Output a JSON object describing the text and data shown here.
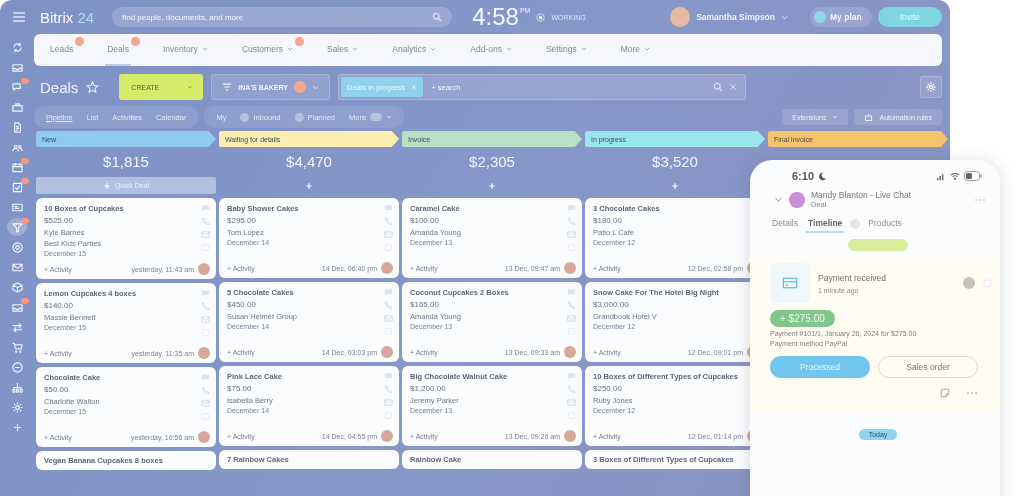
{
  "top_bar": {
    "logo_name": "Bitrix",
    "logo_number": "24",
    "search": {
      "placeholder": "find people, documents, and more"
    },
    "time": "4:58",
    "meridiem": "PM",
    "status": "WORKING",
    "user": "Samantha Simpson",
    "plan": "My plan",
    "invite": "Invite"
  },
  "sidebar": {
    "items": [
      {
        "kind": "sync",
        "badge": false,
        "selected": false
      },
      {
        "kind": "inbox",
        "badge": false,
        "selected": false
      },
      {
        "kind": "chat",
        "badge": true,
        "selected": false
      },
      {
        "kind": "briefcase",
        "badge": false,
        "selected": false
      },
      {
        "kind": "doc",
        "badge": false,
        "selected": false
      },
      {
        "kind": "people",
        "badge": false,
        "selected": false
      },
      {
        "kind": "calendar",
        "badge": true,
        "selected": false
      },
      {
        "kind": "check",
        "badge": true,
        "selected": false
      },
      {
        "kind": "idcard",
        "badge": false,
        "selected": false
      },
      {
        "kind": "funnel",
        "badge": true,
        "selected": true
      },
      {
        "kind": "target",
        "badge": false,
        "selected": false
      },
      {
        "kind": "mail",
        "badge": false,
        "selected": false
      },
      {
        "kind": "box",
        "badge": false,
        "selected": false
      },
      {
        "kind": "inbox",
        "badge": true,
        "selected": false
      },
      {
        "kind": "arrows",
        "badge": false,
        "selected": false
      },
      {
        "kind": "cart",
        "badge": false,
        "selected": false
      },
      {
        "kind": "minus",
        "badge": false,
        "selected": false
      },
      {
        "kind": "tree",
        "badge": false,
        "selected": false
      },
      {
        "kind": "gear",
        "badge": false,
        "selected": false
      },
      {
        "kind": "plus",
        "badge": false,
        "selected": false
      }
    ]
  },
  "nav": {
    "tabs": [
      {
        "label": "Leads",
        "badge": true,
        "dropdown": false,
        "selected": false
      },
      {
        "label": "Deals",
        "badge": true,
        "dropdown": false,
        "selected": true
      },
      {
        "label": "Inventory",
        "badge": false,
        "dropdown": true,
        "selected": false
      },
      {
        "label": "Customers",
        "badge": true,
        "dropdown": true,
        "selected": false
      },
      {
        "label": "Sales",
        "badge": false,
        "dropdown": true,
        "selected": false
      },
      {
        "label": "Analytics",
        "badge": false,
        "dropdown": true,
        "selected": false
      },
      {
        "label": "Add-ons",
        "badge": false,
        "dropdown": true,
        "selected": false
      },
      {
        "label": "Settings",
        "badge": false,
        "dropdown": true,
        "selected": false
      },
      {
        "label": "More",
        "badge": false,
        "dropdown": true,
        "selected": false
      }
    ]
  },
  "toolbar": {
    "title": "Deals",
    "create": "CREATE",
    "filter": "INA'S BAKERY",
    "search_tag": "Deals in progress",
    "search": {
      "placeholder": "+ search"
    }
  },
  "views": {
    "tabs": [
      {
        "label": "Pipeline",
        "selected": true
      },
      {
        "label": "List",
        "selected": false
      },
      {
        "label": "Activities",
        "selected": false
      },
      {
        "label": "Calendar",
        "selected": false
      }
    ],
    "filters": [
      {
        "label": "My",
        "kind": "plain"
      },
      {
        "label": "Inbound",
        "kind": "icon"
      },
      {
        "label": "Planned",
        "kind": "icon"
      },
      {
        "label": "More",
        "kind": "menu"
      }
    ],
    "extensions": "Extensions",
    "automation": "Automation rules"
  },
  "stages": [
    {
      "name": "New",
      "color": "#8fcbef",
      "total": "$1,815",
      "quick_add": "Quick Deal",
      "deals": [
        {
          "title": "10 Boxes of Cupcakes",
          "amount": "$525.00",
          "contact": "Kyle Barnes",
          "company": "Best Kids Parties",
          "date": "December 15",
          "timestamp": "yesterday, 11:43 am",
          "activity": "+ Activity"
        },
        {
          "title": "Lemon Cupcakes 4 boxes",
          "amount": "$140.00",
          "contact": "Massie Bennett",
          "date": "December 15",
          "timestamp": "yesterday, 11:35 am",
          "activity": "+ Activity"
        },
        {
          "title": "Chocolate Cake",
          "amount": "$50.00",
          "contact": "Charlotte Walton",
          "date": "December 15",
          "timestamp": "yesterday, 10:56 am",
          "activity": "+ Activity"
        },
        {
          "title": "Vegan Banana Cupcakes 8 boxes"
        }
      ]
    },
    {
      "name": "Waiting for details",
      "color": "#fbeeb0",
      "total": "$4,470",
      "deals": [
        {
          "title": "Baby Shower Cakes",
          "amount": "$295.00",
          "contact": "Tom Lopez",
          "date": "December 14",
          "timestamp": "14 Dec, 06:40 pm",
          "activity": "+ Activity"
        },
        {
          "title": "5 Chocolate Cakes",
          "amount": "$450.00",
          "contact": "Susan Helmet Group",
          "date": "December 14",
          "timestamp": "14 Dec, 03:03 pm",
          "activity": "+ Activity"
        },
        {
          "title": "Pink Lace Cake",
          "amount": "$75.00",
          "contact": "Isabella Berry",
          "date": "December 14",
          "timestamp": "14 Dec, 04:55 pm",
          "activity": "+ Activity"
        },
        {
          "title": "7 Rainbow Cakes"
        }
      ]
    },
    {
      "name": "Invoice",
      "color": "#b7e0c4",
      "total": "$2,305",
      "deals": [
        {
          "title": "Caramel Cake",
          "amount": "$100.00",
          "contact": "Amanda Young",
          "date": "December 13",
          "timestamp": "13 Dec, 09:47 am",
          "activity": "+ Activity"
        },
        {
          "title": "Coconut Cupcakes 2 Boxes",
          "amount": "$165.00",
          "contact": "Amanda Young",
          "date": "December 13",
          "timestamp": "13 Dec, 09:33 am",
          "activity": "+ Activity"
        },
        {
          "title": "Big Chocolate Walnut Cake",
          "amount": "$1,200.00",
          "contact": "Jeremy Parker",
          "date": "December 13",
          "timestamp": "13 Dec, 09:26 am",
          "activity": "+ Activity"
        },
        {
          "title": "Rainbow Cake"
        }
      ]
    },
    {
      "name": "In progress",
      "color": "#99e6ec",
      "total": "$3,520",
      "deals": [
        {
          "title": "3 Chocolate Cakes",
          "amount": "$180.00",
          "contact": "Patio L Cafe",
          "date": "December 12",
          "timestamp": "12 Dec, 02:58 pm",
          "activity": "+ Activity"
        },
        {
          "title": "Snow Cake For The Hotel Big Night",
          "amount": "$3,000.00",
          "contact": "Grandbook Hotel V",
          "date": "December 12",
          "timestamp": "12 Dec, 09:01 pm",
          "activity": "+ Activity"
        },
        {
          "title": "10 Boxes of Different Types of Cupcakes",
          "amount": "$250.00",
          "contact": "Ruby Jones",
          "date": "December 12",
          "timestamp": "12 Dec, 01:14 pm",
          "activity": "+ Activity"
        },
        {
          "title": "3 Boxes of Different Types of Cupcakes"
        }
      ]
    },
    {
      "name": "Final invoice",
      "color": "#f6c56b"
    }
  ],
  "phone": {
    "time": "6:10",
    "contact": "Mandy Blanton - Live Chat",
    "subtitle": "Deal",
    "tabs": [
      {
        "label": "Details",
        "selected": false
      },
      {
        "label": "Timeline",
        "selected": true
      },
      {
        "label": "Products",
        "selected": false
      }
    ],
    "payment": {
      "title": "Payment received",
      "when": "1 minute ago",
      "amount": "+ $275.00",
      "detail": "Payment #101/1, January 26, 2024 for $275.00",
      "method": "Payment method PayPal",
      "primary": "Processed",
      "secondary": "Sales order"
    },
    "day": "Today"
  }
}
